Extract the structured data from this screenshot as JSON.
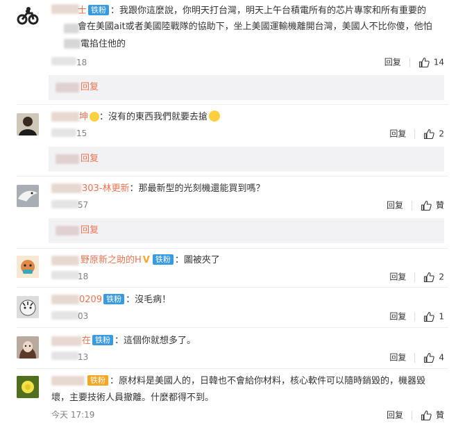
{
  "comments": [
    {
      "name_visible": "士",
      "badge": "铁粉",
      "lines": [
        "：我跟你這麼說，你明天打台灣，明天上午台積電所有的芯片專家和所有重要的",
        "會在美國ait或者美國陸戰隊的協助下，坐上美國運輸機離開台灣，美國人不比你傻，他怕",
        "電掐住他的"
      ],
      "time": "18",
      "reply_label": "回复",
      "like_count": "14",
      "reply_box_label": "回复"
    },
    {
      "name_visible": "坤",
      "badge": "",
      "text": "：沒有的東西我們就要去搶",
      "time": "15",
      "reply_label": "回复",
      "like_count": "2",
      "reply_box_label": "回复"
    },
    {
      "name_visible": "303-林更新",
      "badge": "",
      "text": "：那最新型的光刻機還能買到嗎？",
      "time": "57",
      "reply_label": "回复",
      "like_count": "贊",
      "reply_box_label": "回复"
    },
    {
      "name_visible": "野原新之助的H",
      "badge": "铁粉",
      "text": "：圖被夾了",
      "time": "18",
      "reply_label": "回复",
      "like_count": "2"
    },
    {
      "name_visible": "0209",
      "badge": "铁粉",
      "text": "：沒毛病！",
      "time": "03",
      "reply_label": "回复",
      "like_count": "1"
    },
    {
      "name_visible": "在",
      "badge": "铁粉",
      "text": "：這個你就想多了。",
      "time": "13",
      "reply_label": "回复",
      "like_count": "4"
    },
    {
      "name_visible": "",
      "badge": "铁粉",
      "lines": [
        "：原材料是美國人的，日韓也不會給你材料，核心軟件可以隨時銷毀的，機器毀",
        "壞，主要技術人員撤離。什麼都得不到。"
      ],
      "time": "今天 17:19",
      "reply_label": "回复",
      "like_count": "贊"
    }
  ],
  "colors": {
    "username": "#eb7350",
    "badge_blue": "#3a9ae0",
    "badge_orange": "#f6a623",
    "reply_box_bg": "#f2f2f5",
    "timestamp": "#808080"
  }
}
